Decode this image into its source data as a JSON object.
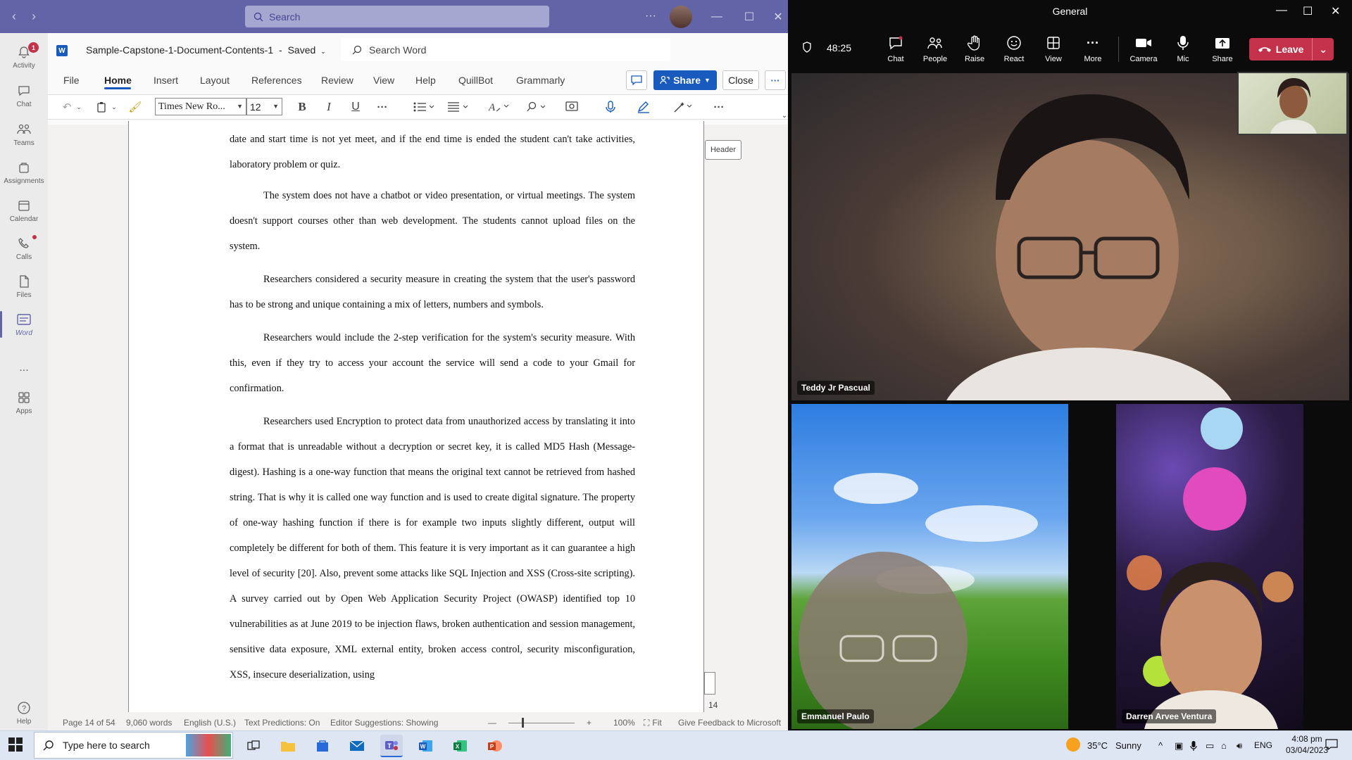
{
  "teams": {
    "search_placeholder": "Search",
    "rail": [
      {
        "label": "Activity",
        "icon": "bell-icon",
        "badge": "1"
      },
      {
        "label": "Chat",
        "icon": "chat-icon"
      },
      {
        "label": "Teams",
        "icon": "teams-icon"
      },
      {
        "label": "Assignments",
        "icon": "assignments-icon"
      },
      {
        "label": "Calendar",
        "icon": "calendar-icon"
      },
      {
        "label": "Calls",
        "icon": "phone-icon"
      },
      {
        "label": "Files",
        "icon": "file-icon"
      },
      {
        "label": "Word",
        "icon": "word-icon"
      },
      {
        "label": "...",
        "icon": "more-icon"
      },
      {
        "label": "Apps",
        "icon": "apps-icon"
      },
      {
        "label": "Help",
        "icon": "help-icon"
      }
    ]
  },
  "word": {
    "doc_title": "Sample-Capstone-1-Document-Contents-1",
    "save_state": "Saved",
    "search_placeholder": "Search Word",
    "menu": [
      "File",
      "Home",
      "Insert",
      "Layout",
      "References",
      "Review",
      "View",
      "Help",
      "QuillBot",
      "Grammarly"
    ],
    "share_label": "Share",
    "close_label": "Close",
    "font_name": "Times New Ro...",
    "font_size": "12",
    "header_tag": "Header",
    "page_number": "14",
    "paragraphs": [
      "date and start time is not yet meet, and if the end time is ended the student can't take activities, laboratory problem or quiz.",
      "The system does not have a chatbot or video presentation, or virtual meetings. The system doesn't support courses other than web development. The students cannot upload files on the system.",
      "Researchers considered a security measure in creating the system that the user's password has to be strong and unique containing a mix of letters, numbers and symbols.",
      "Researchers would include the 2-step verification for the system's security measure. With this, even if they try to access your account the service will send a code to your Gmail for confirmation.",
      "Researchers used Encryption to protect data from unauthorized access by translating it into a format that is unreadable without a decryption or secret key, it is called MD5 Hash (Message-digest). Hashing is a one-way function that means the original text cannot be retrieved from hashed string. That is why it is called one way function and is used to create digital signature. The property of one-way hashing function if there is for example two inputs slightly different, output will completely be different for both of them. This feature it is very important as it can guarantee a high level of security [20]. Also, prevent some attacks like SQL Injection and XSS (Cross-site scripting). A survey carried out by Open Web Application Security Project (OWASP) identified top 10 vulnerabilities as at June 2019 to be injection flaws, broken authentication and session management, sensitive data exposure, XML external entity, broken access control, security misconfiguration, XSS, insecure deserialization, using"
    ],
    "status": {
      "page": "Page 14 of 54",
      "words": "9,060 words",
      "language": "English (U.S.)",
      "predictions": "Text Predictions: On",
      "suggestions": "Editor Suggestions: Showing",
      "zoom": "100%",
      "fit": "Fit",
      "feedback": "Give Feedback to Microsoft"
    }
  },
  "meeting": {
    "title": "General",
    "timer": "48:25",
    "controls": [
      {
        "label": "Chat",
        "icon": "chat-icon"
      },
      {
        "label": "People",
        "icon": "people-icon"
      },
      {
        "label": "Raise",
        "icon": "hand-icon"
      },
      {
        "label": "React",
        "icon": "smile-icon"
      },
      {
        "label": "View",
        "icon": "grid-icon"
      },
      {
        "label": "More",
        "icon": "more-icon"
      },
      {
        "label": "Camera",
        "icon": "camera-icon"
      },
      {
        "label": "Mic",
        "icon": "mic-icon"
      },
      {
        "label": "Share",
        "icon": "share-icon"
      }
    ],
    "leave_label": "Leave",
    "participants": [
      {
        "name": "Teddy Jr Pascual"
      },
      {
        "name": "Emmanuel Paulo"
      },
      {
        "name": "Darren Arvee Ventura"
      }
    ]
  },
  "taskbar": {
    "search_placeholder": "Type here to search",
    "weather_temp": "35°C",
    "weather_text": "Sunny",
    "language": "ENG",
    "time": "4:08 pm",
    "date": "03/04/2023"
  }
}
